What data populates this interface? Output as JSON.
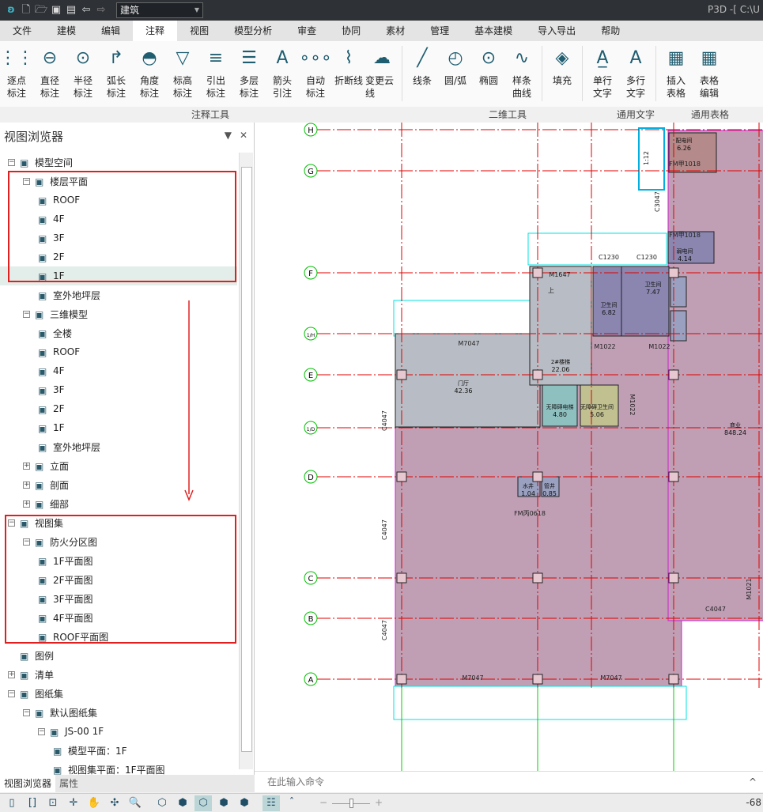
{
  "titlebar": {
    "app_title": "P3D -[ C:\\U",
    "discipline": "建筑",
    "icons": [
      "app-logo-icon",
      "new-file-icon",
      "open-folder-icon",
      "save-icon",
      "save-as-icon",
      "undo-icon",
      "redo-icon"
    ]
  },
  "menu": {
    "items": [
      "文件",
      "建模",
      "编辑",
      "注释",
      "视图",
      "模型分析",
      "审查",
      "协同",
      "素材",
      "管理",
      "基本建模",
      "导入导出",
      "帮助"
    ],
    "active": "注释"
  },
  "ribbon": {
    "groups": [
      "注释工具",
      "二维工具",
      "通用文字",
      "通用表格"
    ],
    "annot": [
      {
        "l1": "逐点",
        "l2": "标注"
      },
      {
        "l1": "直径",
        "l2": "标注"
      },
      {
        "l1": "半径",
        "l2": "标注"
      },
      {
        "l1": "弧长",
        "l2": "标注"
      },
      {
        "l1": "角度",
        "l2": "标注"
      },
      {
        "l1": "标高",
        "l2": "标注"
      },
      {
        "l1": "引出",
        "l2": "标注"
      },
      {
        "l1": "多层",
        "l2": "标注"
      },
      {
        "l1": "箭头",
        "l2": "引注"
      },
      {
        "l1": "自动",
        "l2": "标注"
      },
      {
        "l1": "折断线",
        "l2": ""
      },
      {
        "l1": "变更云线",
        "l2": ""
      }
    ],
    "twod": [
      {
        "l1": "线条",
        "l2": ""
      },
      {
        "l1": "圆/弧",
        "l2": ""
      },
      {
        "l1": "椭圆",
        "l2": ""
      },
      {
        "l1": "样条",
        "l2": "曲线"
      }
    ],
    "fill": {
      "l1": "填充",
      "l2": ""
    },
    "text": [
      {
        "l1": "单行",
        "l2": "文字"
      },
      {
        "l1": "多行",
        "l2": "文字"
      }
    ],
    "table": [
      {
        "l1": "插入",
        "l2": "表格"
      },
      {
        "l1": "表格",
        "l2": "编辑"
      }
    ]
  },
  "panel": {
    "title": "视图浏览器",
    "tabs": [
      "视图浏览器",
      "属性"
    ],
    "active_tab": "视图浏览器",
    "tree": [
      {
        "label": "模型空间",
        "level": 0,
        "exp": "−"
      },
      {
        "label": "楼层平面",
        "level": 1,
        "exp": "−"
      },
      {
        "label": "ROOF",
        "level": 2
      },
      {
        "label": "4F",
        "level": 2
      },
      {
        "label": "3F",
        "level": 2
      },
      {
        "label": "2F",
        "level": 2
      },
      {
        "label": "1F",
        "level": 2,
        "selected": true
      },
      {
        "label": "室外地坪层",
        "level": 2
      },
      {
        "label": "三维模型",
        "level": 1,
        "exp": "−"
      },
      {
        "label": "全楼",
        "level": 2
      },
      {
        "label": "ROOF",
        "level": 2
      },
      {
        "label": "4F",
        "level": 2
      },
      {
        "label": "3F",
        "level": 2
      },
      {
        "label": "2F",
        "level": 2
      },
      {
        "label": "1F",
        "level": 2
      },
      {
        "label": "室外地坪层",
        "level": 2
      },
      {
        "label": "立面",
        "level": 1,
        "exp": "+"
      },
      {
        "label": "剖面",
        "level": 1,
        "exp": "+"
      },
      {
        "label": "细部",
        "level": 1,
        "exp": "+"
      },
      {
        "label": "视图集",
        "level": 0,
        "exp": "−"
      },
      {
        "label": "防火分区图",
        "level": 1,
        "exp": "−"
      },
      {
        "label": "1F平面图",
        "level": 2
      },
      {
        "label": "2F平面图",
        "level": 2
      },
      {
        "label": "3F平面图",
        "level": 2
      },
      {
        "label": "4F平面图",
        "level": 2
      },
      {
        "label": "ROOF平面图",
        "level": 2
      },
      {
        "label": "图例",
        "level": 0
      },
      {
        "label": "清单",
        "level": 0,
        "exp": "+"
      },
      {
        "label": "图纸集",
        "level": 0,
        "exp": "−"
      },
      {
        "label": "默认图纸集",
        "level": 1,
        "exp": "−"
      },
      {
        "label": "JS-00 1F",
        "level": 2,
        "exp": "−"
      },
      {
        "label": "模型平面：1F",
        "level": 3
      },
      {
        "label": "视图集平面：1F平面图",
        "level": 3
      }
    ]
  },
  "drawing": {
    "axes_h": [
      {
        "n": "H"
      },
      {
        "n": "G"
      },
      {
        "n": "F"
      },
      {
        "n": "1/H"
      },
      {
        "n": "E"
      },
      {
        "n": "1/D"
      },
      {
        "n": "D"
      },
      {
        "n": "C"
      },
      {
        "n": "B"
      },
      {
        "n": "A"
      }
    ],
    "rooms": [
      {
        "name": "配电间",
        "area": "6.26"
      },
      {
        "name": "弱电间",
        "area": "4.14"
      },
      {
        "name": "卫生间",
        "area": "6.82"
      },
      {
        "name": "卫生间",
        "area": "7.47"
      },
      {
        "name": "门厅",
        "area": "42.36"
      },
      {
        "name": "2#楼梯",
        "area": "22.06"
      },
      {
        "name": "无障碍电梯",
        "area": "4.80"
      },
      {
        "name": "无障碍卫生间",
        "area": "5.06"
      },
      {
        "name": "商业",
        "area": "848.24"
      },
      {
        "name": "水井",
        "area": "1.04"
      },
      {
        "name": "管井",
        "area": "0.85"
      }
    ],
    "tags": [
      "FM甲1018",
      "FM甲1018",
      "C1230",
      "C1230",
      "M1647",
      "M1022",
      "M1022",
      "M7047",
      "M1022",
      "C4047",
      "C4047",
      "C4047",
      "C4047",
      "FM丙0618",
      "M7047",
      "M7047",
      "C3047",
      "1:12",
      "上",
      "M1021"
    ]
  },
  "command": {
    "placeholder": "在此输入命令"
  },
  "status": {
    "zoom": "-68",
    "icons": [
      "page-icon",
      "fit-icon",
      "window-add-icon",
      "zoom-extents-icon",
      "pan-icon",
      "orbit-icon",
      "zoom-icon",
      "wireframe-icon",
      "hidden-line-icon",
      "shaded-icon",
      "shaded-edges-icon",
      "realistic-icon",
      "layer-icon",
      "expand-icon"
    ]
  },
  "colors": {
    "title_bg": "#2e3136",
    "accent": "#1f7a8c",
    "highlight_box": "#e02020",
    "grid_axis": "#e00000",
    "axis_circle": "#00c000",
    "building_fill": "#c09fb5"
  }
}
